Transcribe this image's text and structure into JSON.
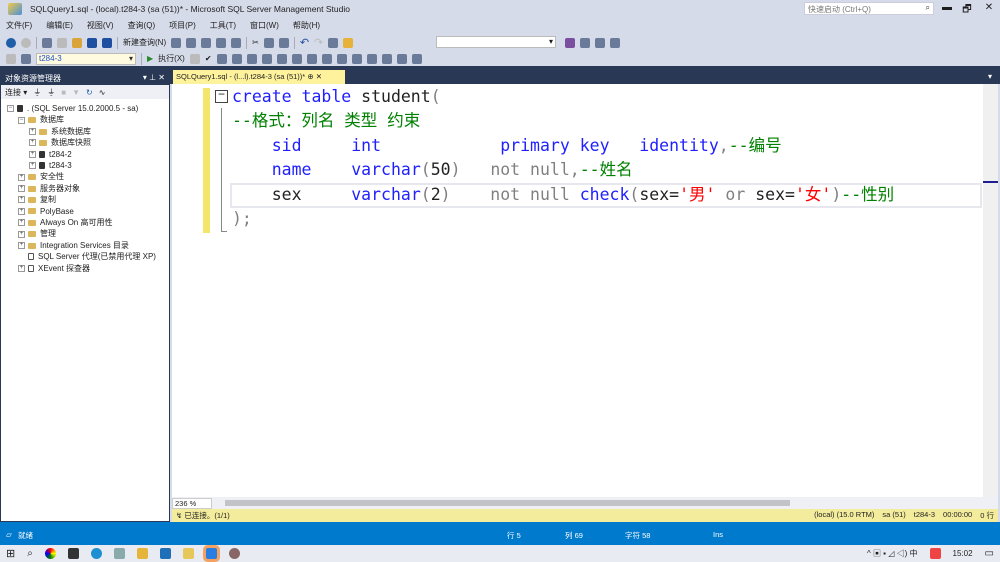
{
  "window": {
    "title": "SQLQuery1.sql - (local).t284-3 (sa (51))* - Microsoft SQL Server Management Studio",
    "quick_launch": "快速启动 (Ctrl+Q)",
    "minimize": "▬",
    "restore": "🗗",
    "close": "✕"
  },
  "menu": [
    "文件(F)",
    "编辑(E)",
    "视图(V)",
    "查询(Q)",
    "项目(P)",
    "工具(T)",
    "窗口(W)",
    "帮助(H)"
  ],
  "toolbar": {
    "new_query": "新建查询(N)",
    "database": "t284-3",
    "execute": "执行(X)"
  },
  "object_explorer": {
    "title": "对象资源管理器",
    "pin": "▾ ⊥ ✕",
    "connect": "连接 ▾",
    "tree": [
      {
        "label": ". (SQL Server 15.0.2000.5 - sa)",
        "level": 0,
        "exp": "⊟",
        "icon": "server"
      },
      {
        "label": "数据库",
        "level": 1,
        "exp": "⊟",
        "icon": "folder"
      },
      {
        "label": "系统数据库",
        "level": 2,
        "exp": "⊞",
        "icon": "folder"
      },
      {
        "label": "数据库快照",
        "level": 2,
        "exp": "⊞",
        "icon": "folder"
      },
      {
        "label": "t284-2",
        "level": 2,
        "exp": "⊞",
        "icon": "db"
      },
      {
        "label": "t284-3",
        "level": 2,
        "exp": "⊞",
        "icon": "db"
      },
      {
        "label": "安全性",
        "level": 1,
        "exp": "⊞",
        "icon": "folder"
      },
      {
        "label": "服务器对象",
        "level": 1,
        "exp": "⊞",
        "icon": "folder"
      },
      {
        "label": "复制",
        "level": 1,
        "exp": "⊞",
        "icon": "folder"
      },
      {
        "label": "PolyBase",
        "level": 1,
        "exp": "⊞",
        "icon": "folder"
      },
      {
        "label": "Always On 高可用性",
        "level": 1,
        "exp": "⊞",
        "icon": "folder"
      },
      {
        "label": "管理",
        "level": 1,
        "exp": "⊞",
        "icon": "folder"
      },
      {
        "label": "Integration Services 目录",
        "level": 1,
        "exp": "⊞",
        "icon": "folder"
      },
      {
        "label": "SQL Server 代理(已禁用代理 XP)",
        "level": 1,
        "exp": "",
        "icon": "agent"
      },
      {
        "label": "XEvent 探查器",
        "level": 1,
        "exp": "⊞",
        "icon": "xevent"
      }
    ]
  },
  "tab": {
    "label": "SQLQuery1.sql - (l...l).t284-3 (sa (51))*",
    "pin": "⊕",
    "close": "✕"
  },
  "editor": {
    "lines": [
      [
        [
          "kw",
          "create table "
        ],
        [
          "tx",
          "student"
        ],
        [
          "gy",
          "("
        ]
      ],
      [
        [
          "cm",
          "--格式：列名 类型 约束"
        ]
      ],
      [
        [
          "tx",
          "    "
        ],
        [
          "kw",
          "sid     int            primary key   identity"
        ],
        [
          "gy",
          ","
        ],
        [
          "cm",
          "--编号"
        ]
      ],
      [
        [
          "tx",
          "    "
        ],
        [
          "kw",
          "name    varchar"
        ],
        [
          "gy",
          "("
        ],
        [
          "tx",
          "50"
        ],
        [
          "gy",
          ")   not null,"
        ],
        [
          "cm",
          "--姓名"
        ]
      ],
      [
        [
          "tx",
          "    sex     "
        ],
        [
          "kw",
          "varchar"
        ],
        [
          "gy",
          "("
        ],
        [
          "tx",
          "2"
        ],
        [
          "gy",
          ")    not null "
        ],
        [
          "kw",
          "check"
        ],
        [
          "gy",
          "("
        ],
        [
          "tx",
          "sex="
        ],
        [
          "st",
          "'男'"
        ],
        [
          "gy",
          " or "
        ],
        [
          "tx",
          "sex="
        ],
        [
          "st",
          "'女'"
        ],
        [
          "gy",
          ")"
        ],
        [
          "cm",
          "--性别"
        ]
      ],
      [
        [
          "gy",
          ");"
        ]
      ]
    ]
  },
  "zoom": "236 %",
  "query_status": {
    "message": "已连接。(1/1)",
    "server": "(local) (15.0 RTM)",
    "user": "sa (51)",
    "database": "t284-3",
    "elapsed": "00:00:00",
    "rows": "0 行"
  },
  "statusbar": {
    "ready": "就绪",
    "line": "行 5",
    "col": "列 69",
    "char": "字符 58",
    "mode": "Ins"
  },
  "taskbar": {
    "time": "15:02"
  }
}
